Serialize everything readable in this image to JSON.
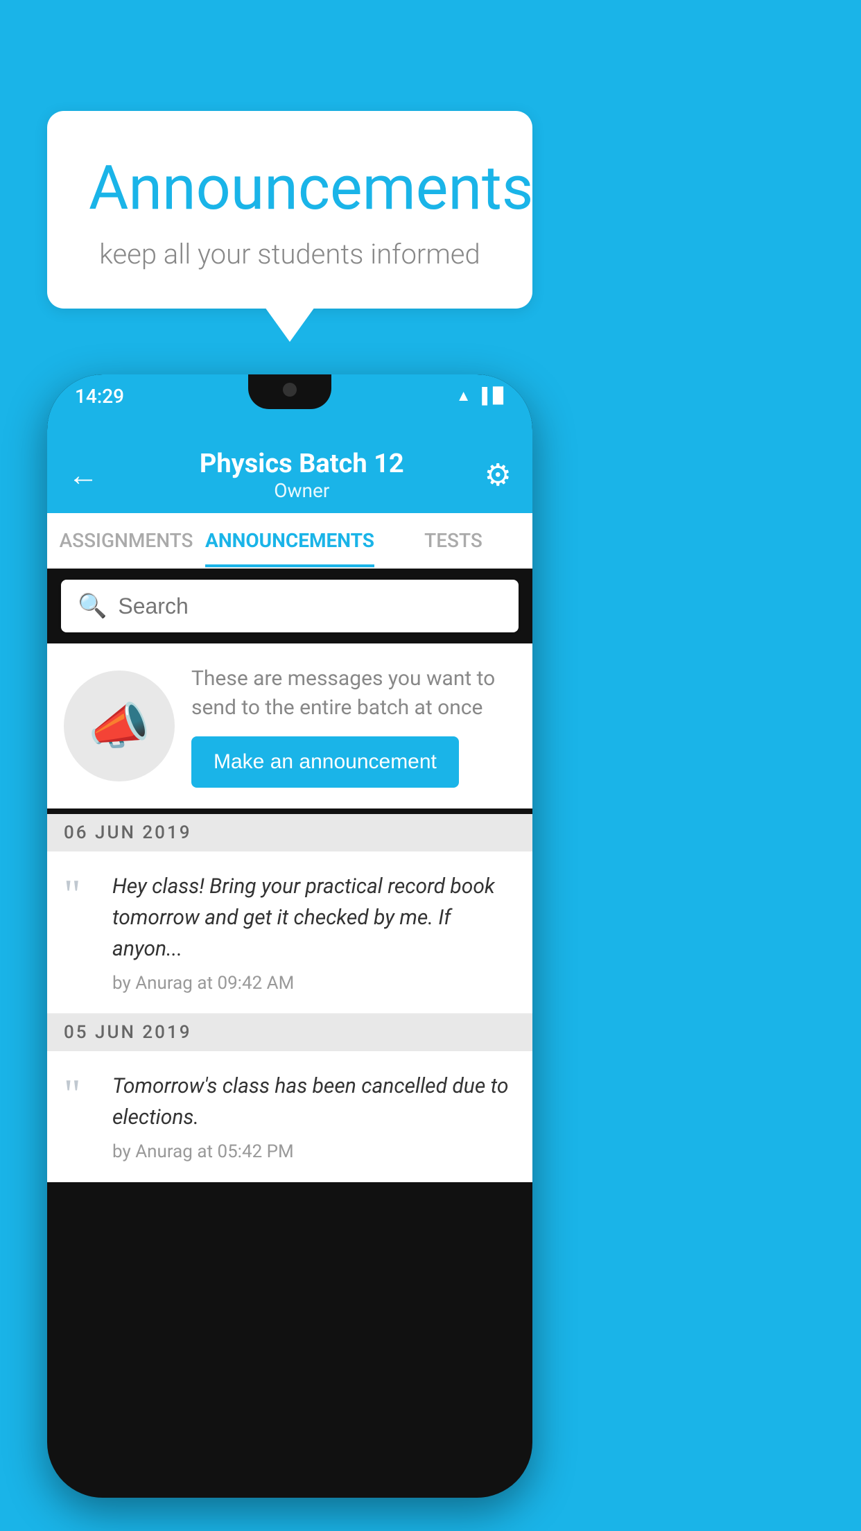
{
  "background_color": "#1ab4e8",
  "speech_bubble": {
    "title": "Announcements",
    "subtitle": "keep all your students informed"
  },
  "phone": {
    "status_bar": {
      "time": "14:29",
      "wifi": "wifi",
      "signal": "signal",
      "battery": "battery"
    },
    "app_bar": {
      "title": "Physics Batch 12",
      "subtitle": "Owner",
      "back_label": "←",
      "gear_label": "⚙"
    },
    "tabs": [
      {
        "label": "ASSIGNMENTS",
        "active": false
      },
      {
        "label": "ANNOUNCEMENTS",
        "active": true
      },
      {
        "label": "TESTS",
        "active": false
      }
    ],
    "search": {
      "placeholder": "Search"
    },
    "promo": {
      "description": "These are messages you want to send to the entire batch at once",
      "button_label": "Make an announcement"
    },
    "announcements": [
      {
        "date": "06  JUN  2019",
        "items": [
          {
            "text": "Hey class! Bring your practical record book tomorrow and get it checked by me. If anyon...",
            "meta": "by Anurag at 09:42 AM"
          }
        ]
      },
      {
        "date": "05  JUN  2019",
        "items": [
          {
            "text": "Tomorrow's class has been cancelled due to elections.",
            "meta": "by Anurag at 05:42 PM"
          }
        ]
      }
    ]
  }
}
